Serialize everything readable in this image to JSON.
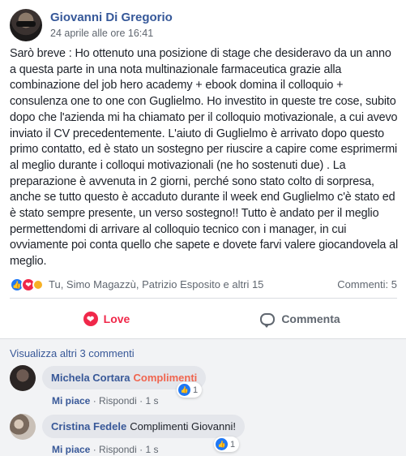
{
  "post": {
    "author": "Giovanni Di Gregorio",
    "timestamp": "24 aprile alle ore 16:41",
    "text": "Sarò breve : Ho ottenuto una posizione di stage che desideravo da un anno a questa parte in una nota multinazionale farmaceutica grazie alla combinazione del job hero academy + ebook domina il colloquio + consulenza one to one con Guglielmo. Ho investito in queste tre cose, subito dopo che l'azienda mi ha chiamato per il colloquio motivazionale, a cui avevo inviato il CV precedentemente. L'aiuto di Guglielmo è arrivato dopo questo primo contatto, ed è stato un sostegno per riuscire a capire come esprimermi al meglio durante i colloqui motivazionali (ne ho sostenuti due) . La preparazione è avvenuta in 2 giorni, perché sono stato colto di sorpresa, anche se tutto questo è accaduto durante il week end Guglielmo c'è stato ed è stato sempre presente, un verso sostegno!! Tutto è andato per il meglio permettendomi di arrivare al colloquio tecnico con i manager, in cui ovviamente poi conta quello che sapete e dovete farvi valere giocandovela al meglio."
  },
  "summary": {
    "reactors": "Tu, Simo Magazzù, Patrizio Esposito e altri 15",
    "comments_count": "Commenti: 5",
    "reaction_icons": [
      "like-icon",
      "love-icon",
      "wow-icon"
    ]
  },
  "actions": {
    "love_label": "Love",
    "comment_label": "Commenta"
  },
  "comments": {
    "view_more": "Visualizza altri 3 commenti",
    "items": [
      {
        "name": "Michela Cortara",
        "text": "Complimenti",
        "likes": "1",
        "like_label": "Mi piace",
        "reply_label": "Rispondi",
        "time": "1 s"
      },
      {
        "name": "Cristina Fedele",
        "text": "Complimenti Giovanni!",
        "likes": "1",
        "like_label": "Mi piace",
        "reply_label": "Rispondi",
        "time": "1 s"
      }
    ]
  },
  "colors": {
    "link": "#365899",
    "love": "#f0284a",
    "like": "#2078f4",
    "highlight": "#f0654f"
  }
}
